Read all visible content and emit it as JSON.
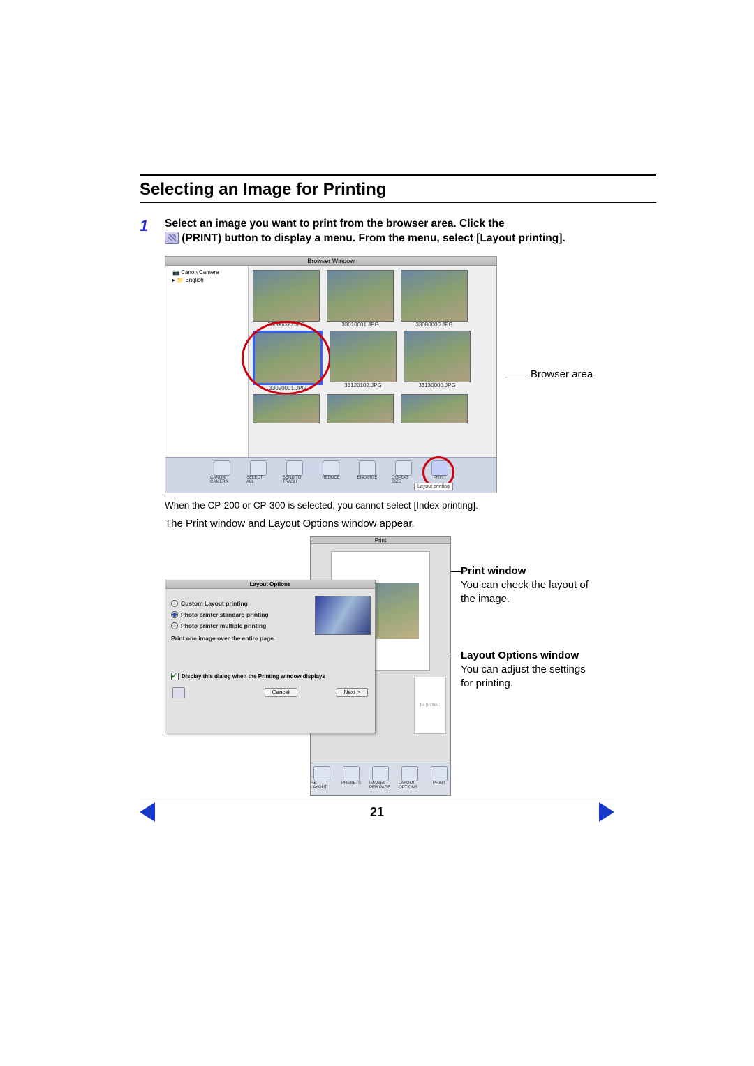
{
  "section_title": "Selecting an Image for Printing",
  "step": {
    "num": "1",
    "line1": "Select an image you want to print from the browser area. Click the",
    "line2_after_icon": " (PRINT) button to display a menu. From the menu, select [Layout printing]."
  },
  "browser_window": {
    "title": "Browser Window",
    "tree": [
      "Canon Camera",
      "English"
    ],
    "thumbs_row1": [
      "33000000.JPG",
      "33010001.JPG",
      "33080000.JPG"
    ],
    "thumbs_row2": [
      "33090001.JPG",
      "33120102.JPG",
      "33130000.JPG"
    ],
    "toolbar": [
      "CANON CAMERA",
      "SELECT ALL",
      "SEND TO TRASH",
      "REDUCE",
      "ENLARGE",
      "DISPLAY SIZE",
      "PRINT"
    ],
    "menu_hint": "Layout printing"
  },
  "browser_label": "Browser area",
  "note": "When the CP-200 or CP-300 is selected, you cannot select [Index printing].",
  "result_text": "The Print window and Layout Options window appear.",
  "print_window": {
    "title": "Print",
    "side_caption": "be printed.",
    "toolbar": [
      "RE-LAYOUT",
      "PRESETS",
      "IMAGES PER PAGE",
      "LAYOUT OPTIONS",
      "PRINT"
    ]
  },
  "layout_options": {
    "title": "Layout Options",
    "radio1": "Custom Layout printing",
    "radio2": "Photo printer standard printing",
    "radio3": "Photo printer multiple printing",
    "desc": "Print one image over the entire page.",
    "checkbox": "Display this dialog when the Printing window displays",
    "cancel": "Cancel",
    "next": "Next >"
  },
  "annotations": {
    "print_title": "Print window",
    "print_body": "You can check the layout of the image.",
    "layout_title": "Layout Options window",
    "layout_body": "You can adjust the settings for printing."
  },
  "page_number": "21"
}
